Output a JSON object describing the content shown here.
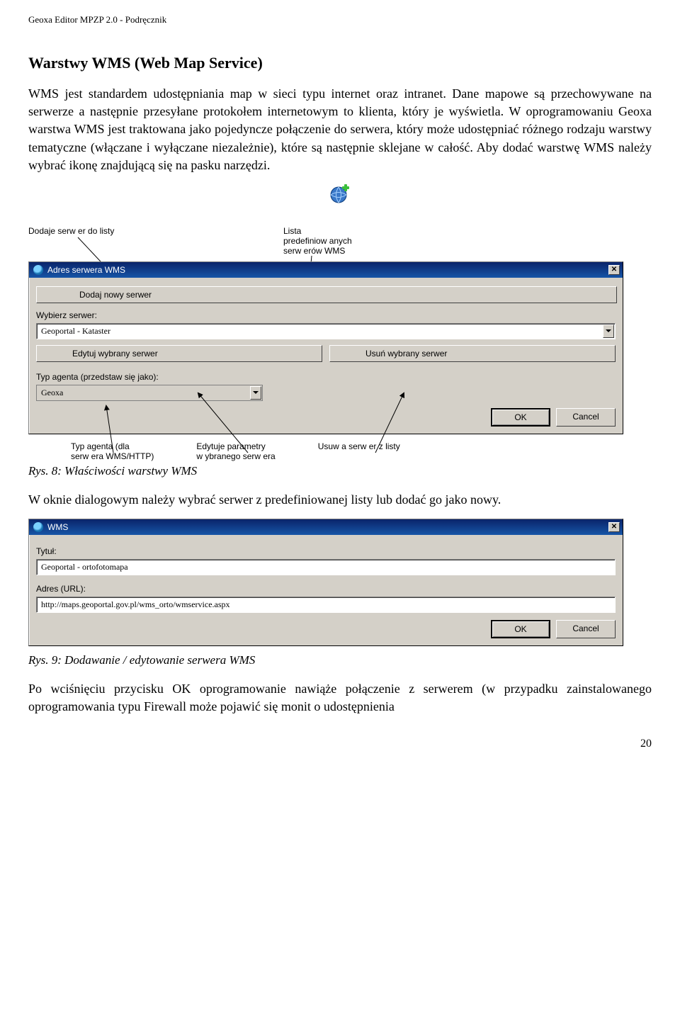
{
  "doc_header": "Geoxa Editor MPZP 2.0 - Podręcznik",
  "section_title": "Warstwy WMS (Web Map Service)",
  "paragraph_1": "WMS jest standardem udostępniania map w sieci typu internet oraz intranet. Dane mapowe są przechowywane na serwerze a następnie przesyłane protokołem internetowym to klienta, który je wyświetla. W oprogramowaniu Geoxa warstwa WMS jest traktowana jako pojedyncze połączenie do serwera, który może udostępniać różnego rodzaju warstwy tematyczne (włączane i wyłączane niezależnie), które są następnie sklejane w całość. Aby dodać warstwę WMS należy wybrać ikonę znajdującą się na pasku narzędzi.",
  "annot": {
    "add_server": "Dodaje serw er do listy",
    "predef_list": "Lista\npredefiniow anych\nserw erów   WMS",
    "agent_type": "Typ agenta (dla\nserw era WMS/HTTP)",
    "edit_params": "Edytuje parametry\nw ybranego serw era",
    "remove_server": "Usuw a serw er z listy"
  },
  "dialog1": {
    "title": "Adres serwera WMS",
    "add_button": "Dodaj nowy serwer",
    "select_label": "Wybierz serwer:",
    "selected_server": "Geoportal - Kataster",
    "edit_button": "Edytuj wybrany serwer",
    "delete_button": "Usuń wybrany serwer",
    "agent_label": "Typ agenta (przedstaw się jako):",
    "agent_value": "Geoxa",
    "ok": "OK",
    "cancel": "Cancel"
  },
  "caption_1": "Rys. 8: Właściwości warstwy WMS",
  "paragraph_2": "W oknie dialogowym należy wybrać serwer z predefiniowanej listy lub dodać go jako nowy.",
  "dialog2": {
    "title": "WMS",
    "title_label": "Tytuł:",
    "title_value": "Geoportal - ortofotomapa",
    "url_label": "Adres (URL):",
    "url_value": "http://maps.geoportal.gov.pl/wms_orto/wmservice.aspx",
    "ok": "OK",
    "cancel": "Cancel"
  },
  "caption_2": "Rys. 9: Dodawanie / edytowanie serwera WMS",
  "paragraph_3": "Po wciśnięciu przycisku OK oprogramowanie nawiąże połączenie z serwerem (w przypadku zainstalowanego oprogramowania typu Firewall może pojawić się monit o udostępnienia",
  "page_number": "20"
}
